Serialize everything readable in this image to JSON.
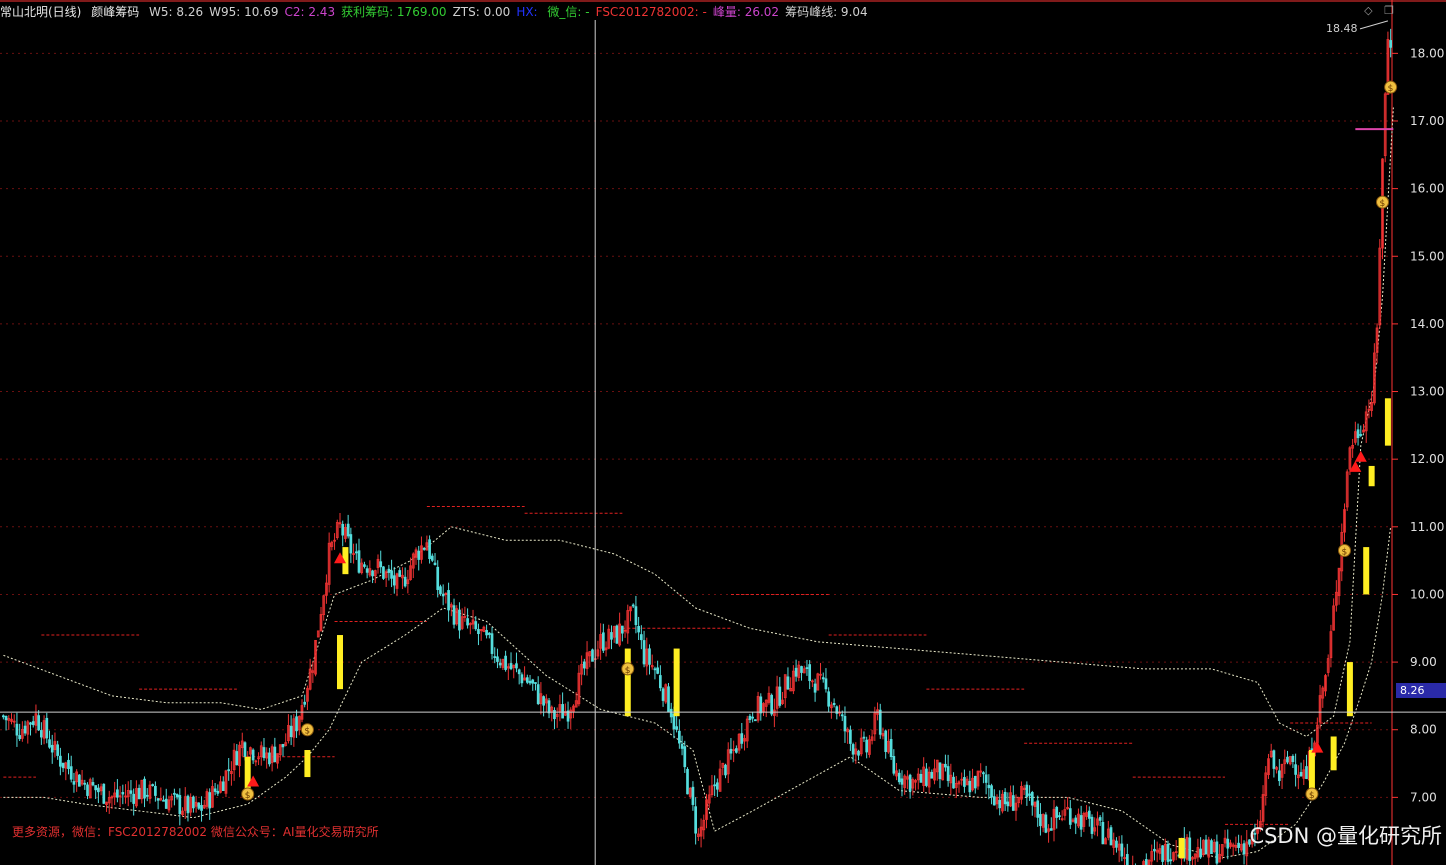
{
  "legend": {
    "title": "常山北明(日线)",
    "indicator": "颜峰筹码",
    "items": [
      {
        "label": "W5:",
        "value": "8.26",
        "color": "#d0d0d0"
      },
      {
        "label": "W95:",
        "value": "10.69",
        "color": "#d0d0d0"
      },
      {
        "label": "C2:",
        "value": "2.43",
        "color": "#cc44cc"
      },
      {
        "label": "获利筹码:",
        "value": "1769.00",
        "color": "#33cc33"
      },
      {
        "label": "ZTS:",
        "value": "0.00",
        "color": "#d0d0d0"
      },
      {
        "label": "HX:",
        "value": "",
        "color": "#2233ff"
      },
      {
        "label": "微_信:",
        "value": "-",
        "color": "#33cc33"
      },
      {
        "label": "FSC2012782002:",
        "value": "-",
        "color": "#ee3333"
      },
      {
        "label": "峰量:",
        "value": "26.02",
        "color": "#cc44cc"
      },
      {
        "label": "筹码峰线:",
        "value": "9.04",
        "color": "#d0d0d0"
      }
    ]
  },
  "window_icons": {
    "diamond": "◇",
    "restore": "❐"
  },
  "footer_note": "更多资源，微信：FSC2012782002 微信公众号：AI量化交易研究所",
  "watermark": "CSDN @量化研究所",
  "current_price_tag": "8.26",
  "peak_label": "18.48",
  "colors": {
    "up": "#ee3333",
    "down": "#55dddd",
    "signal": "#ffee22",
    "chip_line": "#e8e8c8",
    "grid": "#6a1010",
    "axis": "#ff3333"
  },
  "chart_data": {
    "type": "candlestick",
    "ylim": [
      6.0,
      18.7
    ],
    "y_ticks": [
      7.0,
      8.0,
      9.0,
      10.0,
      11.0,
      12.0,
      13.0,
      14.0,
      15.0,
      16.0,
      17.0,
      18.0
    ],
    "y_tick_labels": [
      "7.00",
      "8.00",
      "9.00",
      "10.00",
      "11.00",
      "12.00",
      "13.00",
      "14.00",
      "15.00",
      "16.00",
      "17.00",
      "18.00"
    ],
    "current_price": 8.26,
    "last_high": 18.48,
    "keypoints": [
      [
        0,
        8.2
      ],
      [
        6,
        8.0
      ],
      [
        12,
        8.2
      ],
      [
        20,
        7.6
      ],
      [
        30,
        7.2
      ],
      [
        40,
        7.0
      ],
      [
        52,
        7.1
      ],
      [
        64,
        6.9
      ],
      [
        72,
        6.8
      ],
      [
        80,
        7.2
      ],
      [
        88,
        7.8
      ],
      [
        96,
        7.6
      ],
      [
        102,
        7.7
      ],
      [
        108,
        8.1
      ],
      [
        114,
        9.0
      ],
      [
        120,
        10.6
      ],
      [
        124,
        11.0
      ],
      [
        130,
        10.5
      ],
      [
        138,
        10.4
      ],
      [
        146,
        10.1
      ],
      [
        152,
        10.6
      ],
      [
        156,
        10.8
      ],
      [
        160,
        10.1
      ],
      [
        168,
        9.6
      ],
      [
        176,
        9.4
      ],
      [
        184,
        9.0
      ],
      [
        194,
        8.7
      ],
      [
        202,
        8.2
      ],
      [
        208,
        8.3
      ],
      [
        214,
        8.9
      ],
      [
        220,
        9.3
      ],
      [
        226,
        9.4
      ],
      [
        232,
        9.7
      ],
      [
        236,
        9.1
      ],
      [
        240,
        8.9
      ],
      [
        246,
        8.3
      ],
      [
        252,
        7.2
      ],
      [
        256,
        6.4
      ],
      [
        262,
        7.2
      ],
      [
        268,
        7.6
      ],
      [
        276,
        8.3
      ],
      [
        284,
        8.4
      ],
      [
        292,
        8.9
      ],
      [
        300,
        8.7
      ],
      [
        306,
        8.4
      ],
      [
        312,
        7.8
      ],
      [
        318,
        7.7
      ],
      [
        322,
        8.2
      ],
      [
        328,
        7.4
      ],
      [
        336,
        7.2
      ],
      [
        344,
        7.4
      ],
      [
        352,
        7.1
      ],
      [
        360,
        7.3
      ],
      [
        368,
        6.9
      ],
      [
        376,
        7.0
      ],
      [
        384,
        6.6
      ],
      [
        392,
        6.8
      ],
      [
        400,
        6.6
      ],
      [
        408,
        6.4
      ],
      [
        416,
        6.0
      ],
      [
        424,
        6.1
      ],
      [
        432,
        6.3
      ],
      [
        440,
        6.2
      ],
      [
        448,
        6.2
      ],
      [
        456,
        6.3
      ],
      [
        462,
        6.4
      ],
      [
        466,
        7.6
      ],
      [
        470,
        7.3
      ],
      [
        474,
        7.6
      ],
      [
        480,
        7.3
      ],
      [
        484,
        8.2
      ],
      [
        488,
        9.0
      ],
      [
        492,
        10.5
      ],
      [
        496,
        12.2
      ],
      [
        500,
        12.5
      ],
      [
        504,
        12.9
      ],
      [
        506,
        13.9
      ],
      [
        508,
        16.5
      ],
      [
        510,
        18.2
      ]
    ],
    "bar_count": 512,
    "chip_line_points": [
      [
        0,
        9.1
      ],
      [
        20,
        8.8
      ],
      [
        40,
        8.5
      ],
      [
        60,
        8.4
      ],
      [
        80,
        8.4
      ],
      [
        95,
        8.3
      ],
      [
        110,
        8.5
      ],
      [
        122,
        10.0
      ],
      [
        135,
        10.2
      ],
      [
        150,
        10.5
      ],
      [
        165,
        11.0
      ],
      [
        185,
        10.8
      ],
      [
        205,
        10.8
      ],
      [
        225,
        10.6
      ],
      [
        240,
        10.3
      ],
      [
        255,
        9.8
      ],
      [
        275,
        9.5
      ],
      [
        300,
        9.3
      ],
      [
        330,
        9.2
      ],
      [
        360,
        9.1
      ],
      [
        390,
        9.0
      ],
      [
        420,
        8.9
      ],
      [
        445,
        8.9
      ],
      [
        462,
        8.7
      ],
      [
        470,
        8.1
      ],
      [
        480,
        7.9
      ],
      [
        490,
        8.2
      ],
      [
        496,
        9.3
      ],
      [
        500,
        12.2
      ],
      [
        505,
        13.1
      ],
      [
        508,
        14.4
      ],
      [
        511,
        16.5
      ],
      [
        512,
        17.2
      ]
    ],
    "support_line_points": [
      [
        0,
        7.0
      ],
      [
        15,
        7.0
      ],
      [
        30,
        6.9
      ],
      [
        50,
        6.8
      ],
      [
        70,
        6.7
      ],
      [
        90,
        6.9
      ],
      [
        104,
        7.3
      ],
      [
        112,
        7.6
      ],
      [
        120,
        8.0
      ],
      [
        132,
        9.0
      ],
      [
        148,
        9.4
      ],
      [
        162,
        9.8
      ],
      [
        178,
        9.6
      ],
      [
        200,
        8.8
      ],
      [
        220,
        8.3
      ],
      [
        240,
        8.1
      ],
      [
        254,
        7.7
      ],
      [
        262,
        6.5
      ],
      [
        276,
        6.8
      ],
      [
        294,
        7.2
      ],
      [
        312,
        7.6
      ],
      [
        330,
        7.1
      ],
      [
        360,
        7.0
      ],
      [
        392,
        7.0
      ],
      [
        412,
        6.8
      ],
      [
        430,
        6.3
      ],
      [
        448,
        6.1
      ],
      [
        462,
        6.2
      ],
      [
        476,
        6.6
      ],
      [
        486,
        7.2
      ],
      [
        494,
        7.8
      ],
      [
        500,
        8.5
      ],
      [
        504,
        9.0
      ],
      [
        508,
        10.0
      ],
      [
        511,
        11.0
      ]
    ],
    "resistance_segments": [
      [
        0,
        12,
        7.3
      ],
      [
        14,
        50,
        9.4
      ],
      [
        50,
        86,
        8.6
      ],
      [
        88,
        122,
        7.6
      ],
      [
        122,
        156,
        9.6
      ],
      [
        156,
        192,
        11.3
      ],
      [
        192,
        228,
        11.2
      ],
      [
        228,
        268,
        9.5
      ],
      [
        268,
        304,
        10.0
      ],
      [
        304,
        340,
        9.4
      ],
      [
        340,
        376,
        8.6
      ],
      [
        376,
        416,
        7.8
      ],
      [
        416,
        450,
        7.3
      ],
      [
        450,
        474,
        6.6
      ],
      [
        474,
        504,
        8.1
      ]
    ],
    "arrow_up_bars": [
      92,
      124,
      484,
      500,
      498
    ],
    "money_bag_bars": [
      90,
      112,
      230,
      482,
      494,
      508,
      514
    ],
    "signal_bars": [
      [
        90,
        7.0,
        7.6
      ],
      [
        112,
        7.3,
        7.7
      ],
      [
        124,
        8.6,
        9.4
      ],
      [
        126,
        10.3,
        10.7
      ],
      [
        230,
        8.2,
        9.2
      ],
      [
        248,
        8.2,
        9.2
      ],
      [
        434,
        6.1,
        6.4
      ],
      [
        482,
        7.1,
        7.7
      ],
      [
        490,
        7.4,
        7.9
      ],
      [
        496,
        8.2,
        9.0
      ],
      [
        502,
        10.0,
        10.7
      ],
      [
        504,
        11.6,
        11.9
      ],
      [
        510,
        12.2,
        12.9
      ]
    ]
  }
}
